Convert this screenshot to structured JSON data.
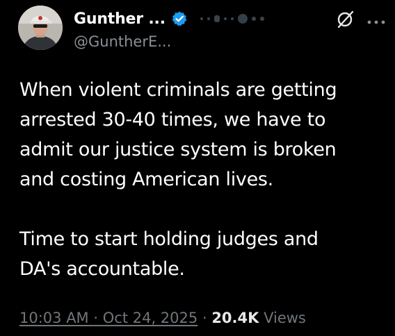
{
  "author": {
    "display_name": "Gunther ...",
    "handle": "@GuntherE...",
    "verified": true,
    "verified_color": "#1d9bf0"
  },
  "icons": {
    "verified": "verified-badge-icon",
    "grok": "grok-icon",
    "more": "more-options-icon"
  },
  "tweet": {
    "paragraphs": [
      "When violent criminals are getting\narrested 30-40 times,  we have to\nadmit our justice system is broken\nand costing American lives.",
      "Time to start holding judges and\nDA's accountable."
    ]
  },
  "meta": {
    "time": "10:03 AM",
    "separator": "·",
    "date": "Oct 24, 2025",
    "views_count": "20.4K",
    "views_label": "Views"
  },
  "colors": {
    "background": "#000000",
    "text_primary": "#ffffff",
    "text_secondary": "#71767b",
    "accent": "#1d9bf0"
  }
}
